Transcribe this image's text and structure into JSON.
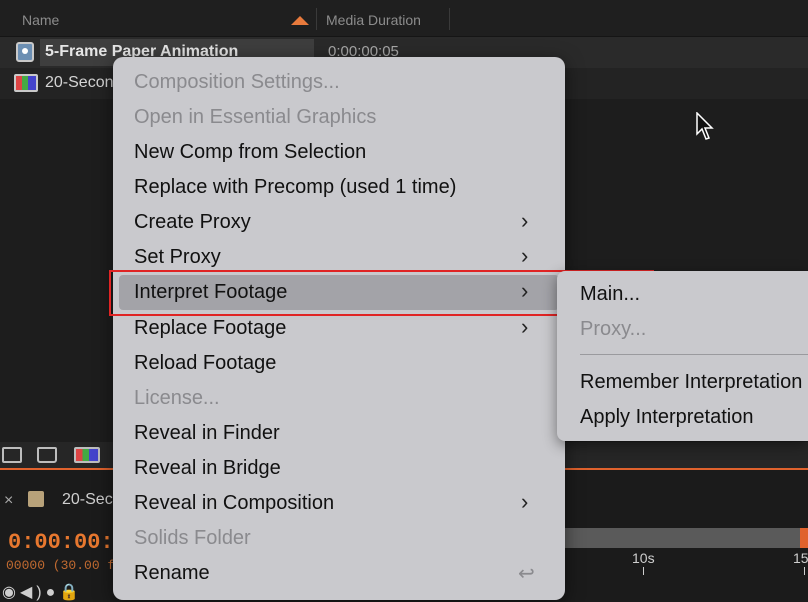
{
  "project": {
    "columns": {
      "name": "Name",
      "duration": "Media Duration"
    },
    "rows": [
      {
        "name": "5-Frame Paper Animation",
        "duration": "0:00:00:05"
      },
      {
        "name": "20-Secon"
      }
    ]
  },
  "timeline": {
    "close": "×",
    "comp_name": "20-Sec",
    "timecode": "0:00:00:0",
    "fps_line": "00000 (30.00 fp",
    "ticks": [
      "10s",
      "15"
    ],
    "controls": "◉◀)●🔒"
  },
  "context_menu": {
    "items": [
      {
        "label": "Composition Settings...",
        "disabled": true
      },
      {
        "label": "Open in Essential Graphics",
        "disabled": true
      },
      {
        "label": "New Comp from Selection"
      },
      {
        "label": "Replace with Precomp (used 1 time)"
      },
      {
        "label": "Create Proxy",
        "submenu": "›"
      },
      {
        "label": "Set Proxy",
        "submenu": "›"
      },
      {
        "label": "Interpret Footage",
        "submenu": "›",
        "highlighted": true
      },
      {
        "label": "Replace Footage",
        "submenu": "›"
      },
      {
        "label": "Reload Footage"
      },
      {
        "label": "License...",
        "disabled": true
      },
      {
        "label": "Reveal in Finder"
      },
      {
        "label": "Reveal in Bridge"
      },
      {
        "label": "Reveal in Composition",
        "submenu": "›"
      },
      {
        "label": "Solids Folder",
        "disabled": true
      },
      {
        "label": "Rename",
        "shortcut": "↩"
      }
    ]
  },
  "submenu": {
    "items": [
      {
        "label": "Main..."
      },
      {
        "label": "Proxy...",
        "disabled": true
      },
      {
        "label": "Remember Interpretation"
      },
      {
        "label": "Apply Interpretation"
      }
    ]
  },
  "colors": {
    "accent_orange": "#e0622d",
    "highlight_box": "#e02424",
    "menu_bg": "#c9c9cd"
  }
}
